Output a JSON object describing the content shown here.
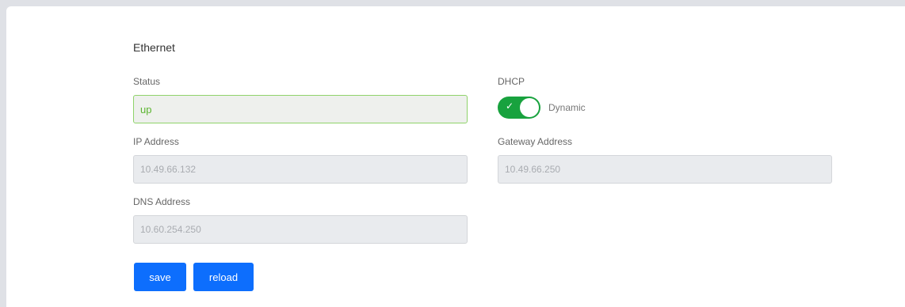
{
  "section": {
    "title": "Ethernet"
  },
  "status": {
    "label": "Status",
    "value": "up"
  },
  "dhcp": {
    "label": "DHCP",
    "enabled": true,
    "mode_label": "Dynamic"
  },
  "ip": {
    "label": "IP Address",
    "value": "10.49.66.132"
  },
  "gateway": {
    "label": "Gateway Address",
    "value": "10.49.66.250"
  },
  "dns": {
    "label": "DNS Address",
    "value": "10.60.254.250"
  },
  "buttons": {
    "save": "save",
    "reload": "reload"
  },
  "colors": {
    "accent": "#0d6efd",
    "toggle_on": "#18a23e",
    "status_border": "#8fd36a",
    "status_text": "#5cb531"
  },
  "icons": {
    "toggle_check": "check-icon"
  }
}
